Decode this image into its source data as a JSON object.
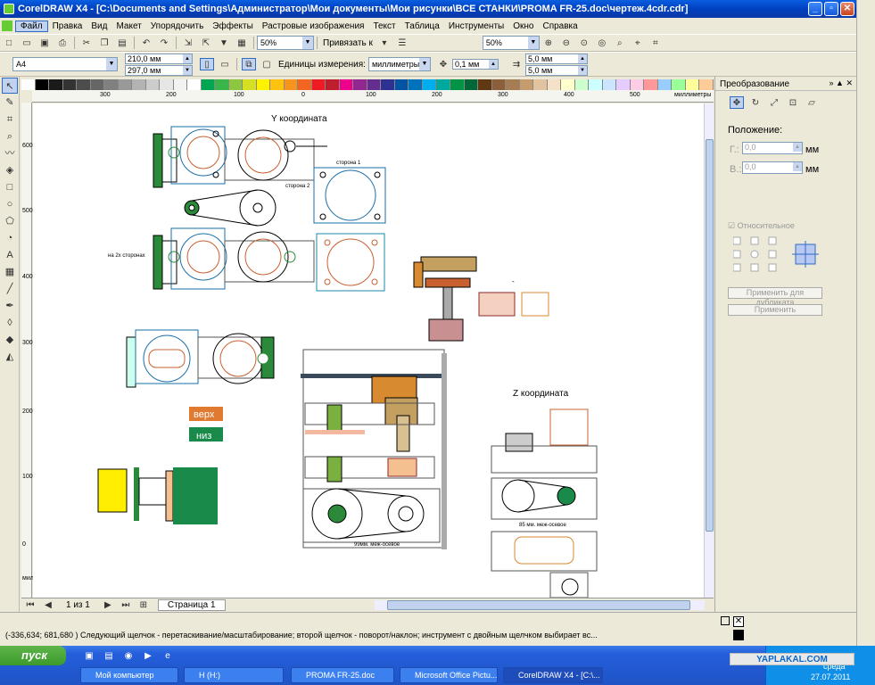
{
  "window": {
    "title": "CorelDRAW X4 - [C:\\Documents and Settings\\Администратор\\Мои документы\\Мои рисунки\\ВСЕ СТАНКИ\\PROMA FR-25.doc\\чертеж.4cdr.cdr]",
    "min": "_",
    "max": "▫",
    "close": "✕"
  },
  "menu": [
    "Файл",
    "Правка",
    "Вид",
    "Макет",
    "Упорядочить",
    "Эффекты",
    "Растровые изображения",
    "Текст",
    "Таблица",
    "Инструменты",
    "Окно",
    "Справка"
  ],
  "toolbar1": {
    "zoom1": "50%",
    "snap": "Привязать к",
    "zoom2": "50%"
  },
  "toolbar2": {
    "page_size": "A4",
    "width": "210,0 мм",
    "height": "297,0 мм",
    "units_label": "Единицы измерения:",
    "units": "миллиметры",
    "nudge": "0,1 мм",
    "dup_x": "5,0 мм",
    "dup_y": "5,0 мм"
  },
  "ruler_h": [
    "300",
    "200",
    "100",
    "0",
    "100",
    "200",
    "300",
    "400",
    "500"
  ],
  "ruler_h_unit": "миллиметры",
  "ruler_v": [
    "600",
    "500",
    "400",
    "300",
    "200",
    "100",
    "0"
  ],
  "ruler_v_unit": "миллиметры",
  "palette": [
    "#ffffff",
    "#000000",
    "#1a1a1a",
    "#333333",
    "#4d4d4d",
    "#666666",
    "#808080",
    "#999999",
    "#b3b3b3",
    "#cccccc",
    "#e6e6e6",
    "#f2f2f2",
    "#ffffff",
    "#00a651",
    "#39b54a",
    "#8dc63f",
    "#d7df23",
    "#fff200",
    "#ffc20e",
    "#f7941d",
    "#f26522",
    "#ed1c24",
    "#be1e2d",
    "#ec008c",
    "#92278f",
    "#662d91",
    "#2e3192",
    "#0054a6",
    "#0072bc",
    "#00aeef",
    "#00a99d",
    "#009444",
    "#006838",
    "#603913",
    "#8b5e3c",
    "#a67c52",
    "#c69c6d",
    "#e2c3a0",
    "#f5e1c8",
    "#ffffcc",
    "#ccffcc",
    "#ccffff",
    "#cce5ff",
    "#e5ccff",
    "#ffcce5",
    "#ff9999",
    "#99ccff",
    "#99ff99",
    "#ffff99",
    "#ffcc99"
  ],
  "canvas_labels": {
    "y_coord": "Y координата",
    "z_coord": "Z координата",
    "side1": "сторона 1",
    "side2": "сторона 2",
    "two_sides": "на 2х сторонах",
    "top": "верх",
    "bottom": "низ",
    "axis99": "99мм. меж-осевое",
    "axis85": "85 мм. меж-осевое",
    "dash": "-"
  },
  "docker": {
    "title": "Преобразование",
    "position_label": "Положение:",
    "h_label": "Г.:",
    "h_val": "0,0",
    "h_unit": "мм",
    "v_label": "В.:",
    "v_val": "0,0",
    "v_unit": "мм",
    "relative": "Относительное",
    "apply_dup": "Применить для дубликата",
    "apply": "Применить"
  },
  "pagebar": {
    "count": "1 из 1",
    "tab": "Страница 1"
  },
  "status": {
    "coords": "(-336,634; 681,680 )",
    "hint": "Следующий щелчок - перетаскивание/масштабирование; второй щелчок - поворот/наклон; инструмент с двойным щелчком выбирает вс..."
  },
  "taskbar": {
    "start": "пуск",
    "tasks": [
      "Мой компьютер",
      "H (H:)",
      "PROMA FR-25.doc",
      "Microsoft Office Pictu...",
      "CorelDRAW X4 - [C:\\..."
    ],
    "clock_day": "среда",
    "clock_date": "27.07.2011",
    "watermark": "YAPLAKAL.COM"
  }
}
